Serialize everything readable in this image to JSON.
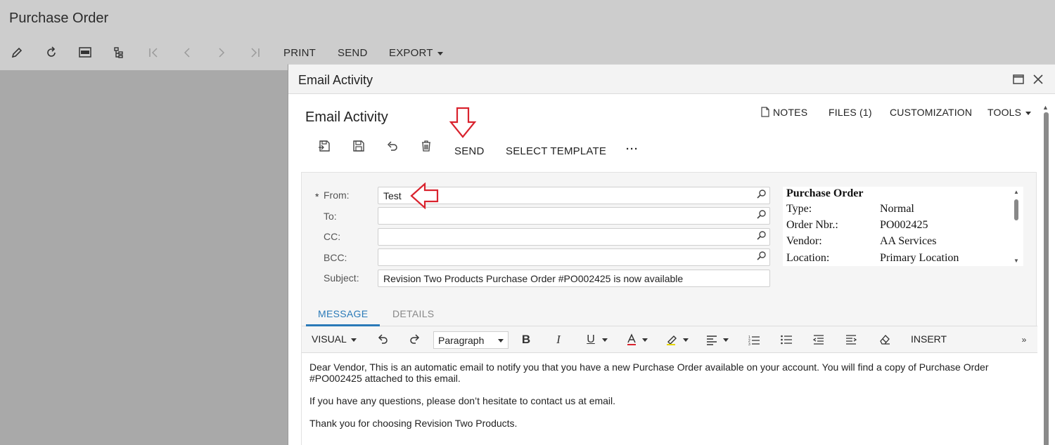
{
  "background": {
    "title": "Purchase Order",
    "toolbar": {
      "print_label": "PRINT",
      "send_label": "SEND",
      "export_label": "EXPORT"
    }
  },
  "modal": {
    "title": "Email Activity",
    "screen_title": "Email Activity",
    "top_links": {
      "notes": "NOTES",
      "files": "FILES (1)",
      "customization": "CUSTOMIZATION",
      "tools": "TOOLS"
    },
    "actions": {
      "send": "SEND",
      "select_template": "SELECT TEMPLATE",
      "more": "···"
    },
    "form": {
      "required_mark": "*",
      "from_label": "From:",
      "from_value": "Test",
      "to_label": "To:",
      "to_value": "",
      "cc_label": "CC:",
      "cc_value": "",
      "bcc_label": "BCC:",
      "bcc_value": "",
      "subject_label": "Subject:",
      "subject_value": "Revision Two Products Purchase Order #PO002425 is now available"
    },
    "preview": {
      "title": "Purchase Order",
      "rows": [
        {
          "key": "Type:",
          "value": "Normal"
        },
        {
          "key": "Order Nbr.:",
          "value": "PO002425"
        },
        {
          "key": "Vendor:",
          "value": "AA Services"
        },
        {
          "key": "Location:",
          "value": "Primary Location"
        }
      ]
    },
    "tabs": {
      "message": "MESSAGE",
      "details": "DETAILS"
    },
    "editor_toolbar": {
      "visual": "VISUAL",
      "paragraph": "Paragraph",
      "insert": "INSERT"
    },
    "message": {
      "p1": "Dear Vendor, This is an automatic email to notify you that you have a new Purchase Order available on your account. You will find a copy of Purchase Order #PO002425 attached to this email.",
      "p2": "If you have any questions, please don’t hesitate to contact us at email.",
      "p3": "Thank you for choosing Revision Two Products."
    }
  },
  "annotation_color": "#d9232e"
}
